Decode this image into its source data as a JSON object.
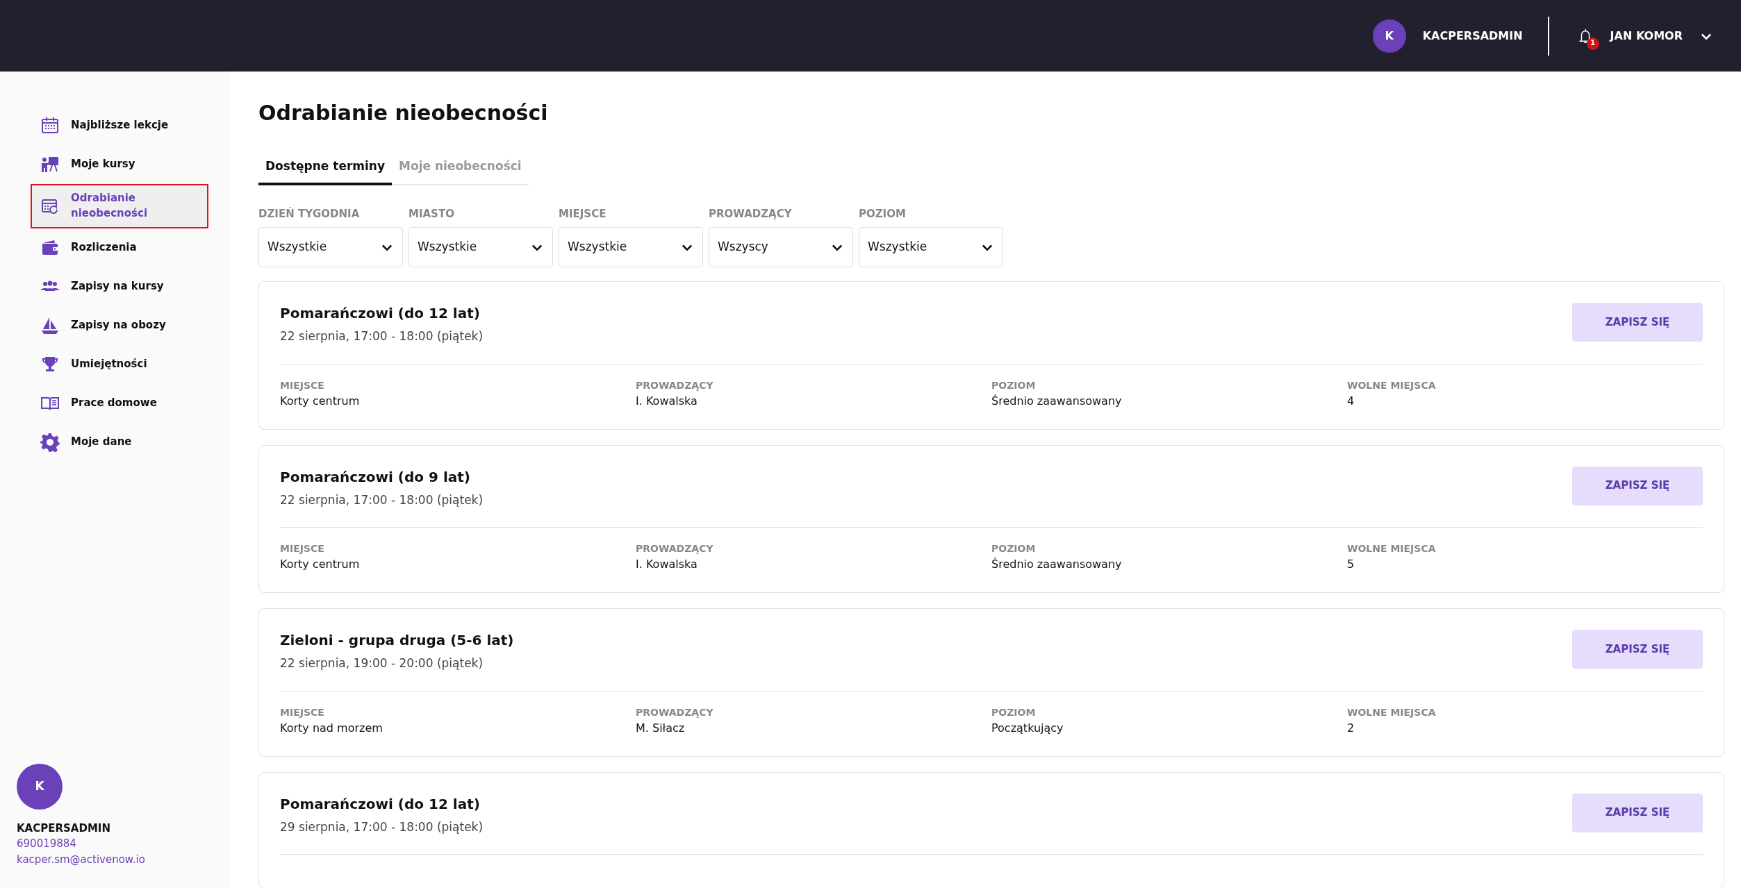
{
  "header": {
    "avatar_letter": "K",
    "account": "KACPERSADMIN",
    "notifications": "1",
    "user": "JAN KOMOR"
  },
  "sidebar": {
    "items": [
      {
        "label": "Najbliższe lekcje",
        "selected": false
      },
      {
        "label": "Moje kursy",
        "selected": false
      },
      {
        "label": "Odrabianie nieobecności",
        "selected": true
      },
      {
        "label": "Rozliczenia",
        "selected": false
      },
      {
        "label": "Zapisy na kursy",
        "selected": false
      },
      {
        "label": "Zapisy na obozy",
        "selected": false
      },
      {
        "label": "Umiejętności",
        "selected": false
      },
      {
        "label": "Prace domowe",
        "selected": false
      },
      {
        "label": "Moje dane",
        "selected": false
      }
    ],
    "profile": {
      "avatar_letter": "K",
      "name": "KACPERSADMIN",
      "phone": "690019884",
      "email": "kacper.sm@activenow.io"
    }
  },
  "page": {
    "title": "Odrabianie nieobecności",
    "tabs": [
      {
        "label": "Dostępne terminy",
        "selected": true
      },
      {
        "label": "Moje nieobecności",
        "selected": false
      }
    ],
    "filters": [
      {
        "label": "DZIEŃ TYGODNIA",
        "value": "Wszystkie"
      },
      {
        "label": "MIASTO",
        "value": "Wszystkie"
      },
      {
        "label": "MIEJSCE",
        "value": "Wszystkie"
      },
      {
        "label": "PROWADZĄCY",
        "value": "Wszyscy"
      },
      {
        "label": "POZIOM",
        "value": "Wszystkie"
      }
    ],
    "slots": [
      {
        "title": "Pomarańczowi (do 12 lat)",
        "date": "22 sierpnia, 17:00 - 18:00 (piątek)",
        "button": "ZAPISZ SIĘ",
        "details": [
          {
            "label": "MIEJSCE",
            "value": "Korty centrum"
          },
          {
            "label": "PROWADZĄCY",
            "value": "I. Kowalska"
          },
          {
            "label": "POZIOM",
            "value": "Średnio zaawansowany"
          },
          {
            "label": "WOLNE MIEJSCA",
            "value": "4"
          }
        ]
      },
      {
        "title": "Pomarańczowi (do 9 lat)",
        "date": "22 sierpnia, 17:00 - 18:00 (piątek)",
        "button": "ZAPISZ SIĘ",
        "details": [
          {
            "label": "MIEJSCE",
            "value": "Korty centrum"
          },
          {
            "label": "PROWADZĄCY",
            "value": "I. Kowalska"
          },
          {
            "label": "POZIOM",
            "value": "Średnio zaawansowany"
          },
          {
            "label": "WOLNE MIEJSCA",
            "value": "5"
          }
        ]
      },
      {
        "title": "Zieloni - grupa druga (5-6 lat)",
        "date": "22 sierpnia, 19:00 - 20:00 (piątek)",
        "button": "ZAPISZ SIĘ",
        "details": [
          {
            "label": "MIEJSCE",
            "value": "Korty nad morzem"
          },
          {
            "label": "PROWADZĄCY",
            "value": "M. Siłacz"
          },
          {
            "label": "POZIOM",
            "value": "Początkujący"
          },
          {
            "label": "WOLNE MIEJSCA",
            "value": "2"
          }
        ]
      },
      {
        "title": "Pomarańczowi (do 12 lat)",
        "date": "29 sierpnia, 17:00 - 18:00 (piątek)",
        "button": "ZAPISZ SIĘ"
      }
    ]
  }
}
